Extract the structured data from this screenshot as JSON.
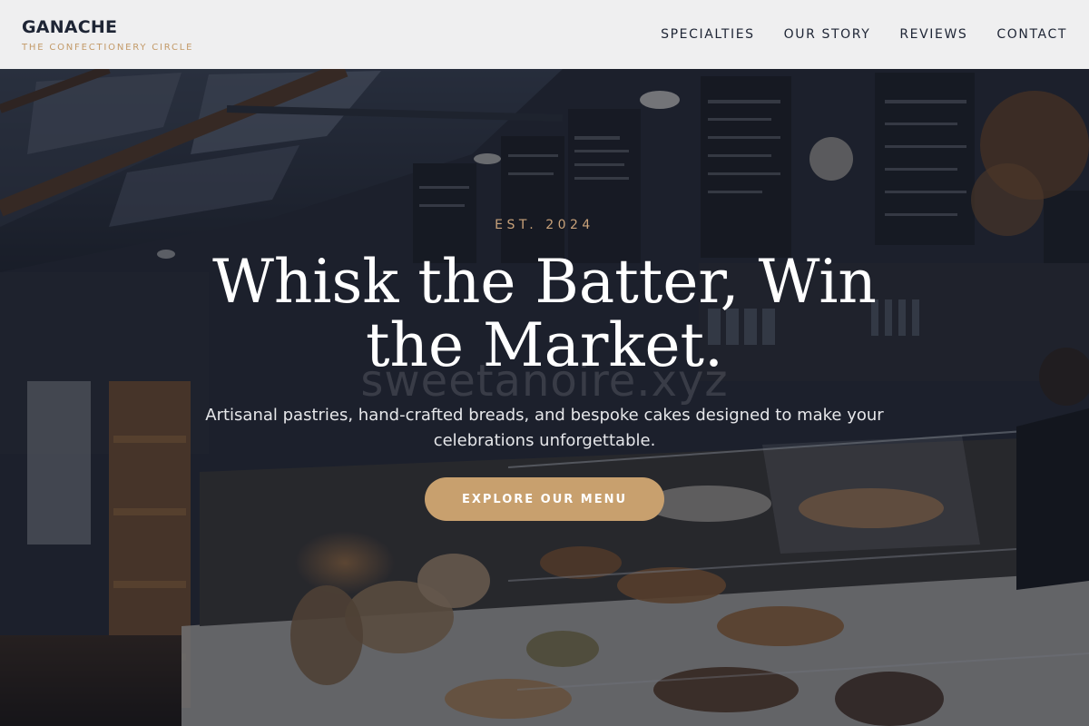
{
  "brand": {
    "name": "GANACHE",
    "tagline": "THE CONFECTIONERY CIRCLE"
  },
  "nav": {
    "items": [
      {
        "label": "SPECIALTIES"
      },
      {
        "label": "OUR STORY"
      },
      {
        "label": "REVIEWS"
      },
      {
        "label": "CONTACT"
      }
    ]
  },
  "hero": {
    "eyebrow": "EST. 2024",
    "title": "Whisk the Batter, Win the Market.",
    "subtitle": "Artisanal pastries, hand-crafted breads, and bespoke cakes designed to make your celebrations unforgettable.",
    "cta_label": "EXPLORE OUR MENU",
    "watermark": "sweetanoire.xyz"
  },
  "colors": {
    "accent": "#c8a06e",
    "eyebrow": "#c9a27a",
    "header_bg": "#f8f8f9",
    "brand_text": "#1e2535"
  }
}
